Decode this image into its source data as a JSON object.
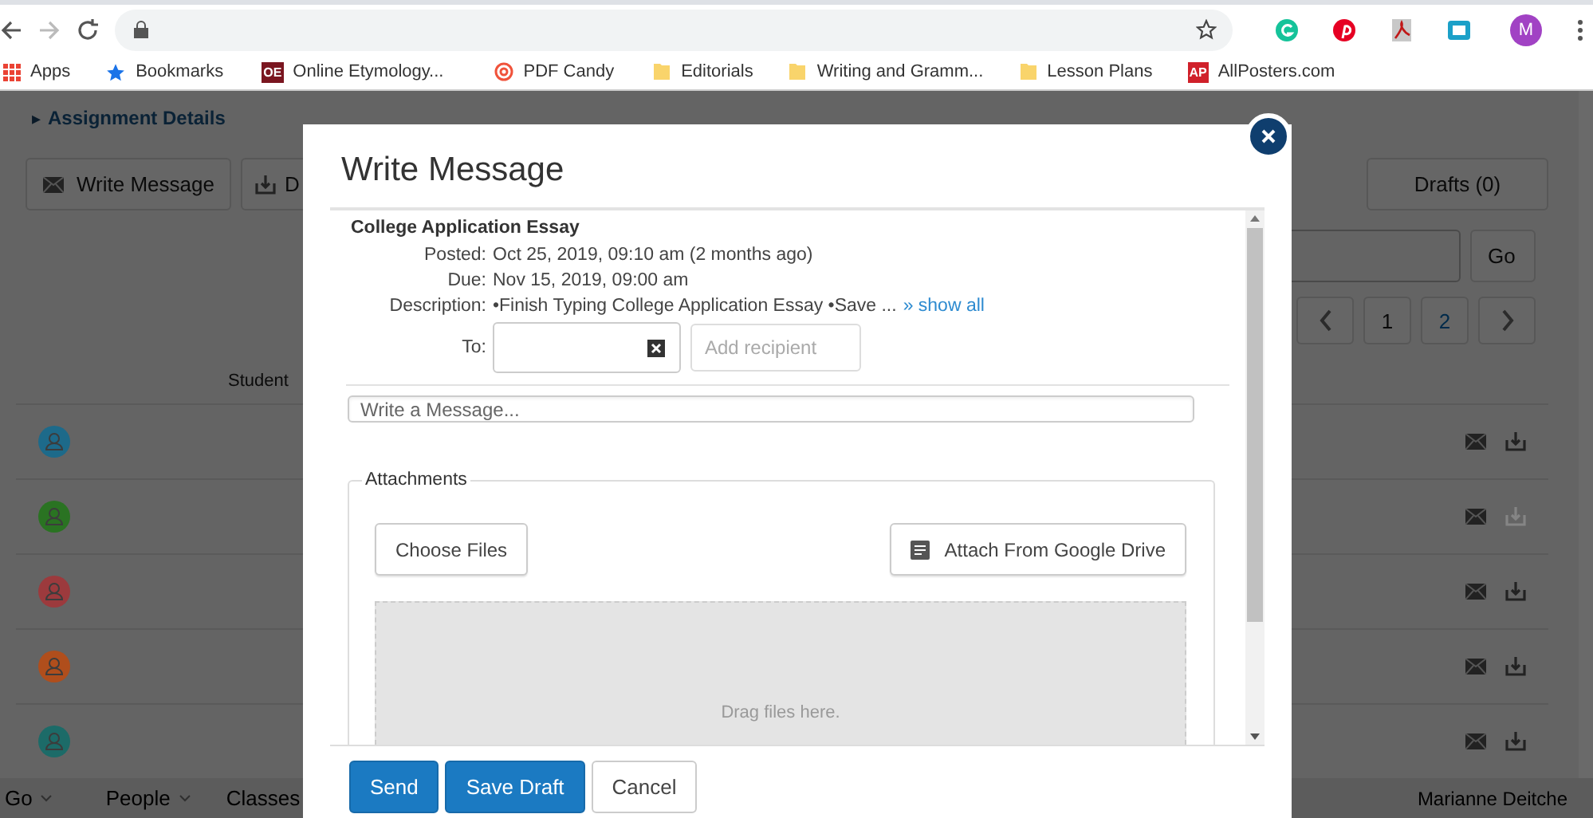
{
  "browser": {
    "profile_initial": "M",
    "bookmarks": [
      {
        "label": "Apps",
        "kind": "apps"
      },
      {
        "label": "Bookmarks",
        "kind": "star"
      },
      {
        "label": "Online Etymology...",
        "kind": "badge",
        "badge": "OE",
        "color": "#7a1620"
      },
      {
        "label": "PDF Candy",
        "kind": "candy"
      },
      {
        "label": "Editorials",
        "kind": "folder"
      },
      {
        "label": "Writing and Gramm...",
        "kind": "folder"
      },
      {
        "label": "Lesson Plans",
        "kind": "folder"
      },
      {
        "label": "AllPosters.com",
        "kind": "badge",
        "badge": "AP",
        "color": "#d0202a"
      }
    ]
  },
  "page": {
    "section_marker": "▸",
    "section_title": "Assignment Details",
    "toolbar": [
      {
        "label": "Write Message",
        "kind": "mail"
      },
      {
        "label": "D",
        "kind": "download"
      }
    ],
    "drafts_button": "Drafts (0)",
    "go_button": "Go",
    "pagination": [
      {
        "kind": "prev"
      },
      {
        "kind": "page",
        "label": "1",
        "selected": false
      },
      {
        "kind": "page",
        "label": "2",
        "selected": true
      },
      {
        "kind": "next"
      }
    ],
    "table_header": "Student",
    "rows": [
      {
        "color": "#1d6a8a",
        "download_disabled": false
      },
      {
        "color": "#2a7322",
        "download_disabled": true
      },
      {
        "color": "#9c3a3d",
        "download_disabled": false
      },
      {
        "color": "#b04e1c",
        "download_disabled": false
      },
      {
        "color": "#1c6b68",
        "download_disabled": false
      }
    ],
    "bottom_nav": [
      {
        "label": "Go"
      },
      {
        "label": "People"
      },
      {
        "label": "Classes"
      }
    ],
    "user_name": "Marianne Deitche"
  },
  "modal": {
    "title": "Write Message",
    "assignment": "College Application Essay",
    "details": [
      {
        "label": "Posted:",
        "value": "Oct 25, 2019, 09:10 am (2 months ago)"
      },
      {
        "label": "Due:",
        "value": "Nov 15, 2019, 09:00 am"
      },
      {
        "label": "Description:",
        "value": "•Finish Typing College Application Essay •Save ...",
        "link": "» show all"
      }
    ],
    "to_label": "To:",
    "recipient_placeholder": "Add recipient",
    "message_placeholder": "Write a Message...",
    "attachments_legend": "Attachments",
    "choose_files": "Choose Files",
    "drive_button": "Attach From Google Drive",
    "drop_hint": "Drag files here.",
    "buttons": [
      {
        "label": "Send",
        "kind": "primary"
      },
      {
        "label": "Save Draft",
        "kind": "primary"
      },
      {
        "label": "Cancel",
        "kind": "default"
      }
    ]
  }
}
